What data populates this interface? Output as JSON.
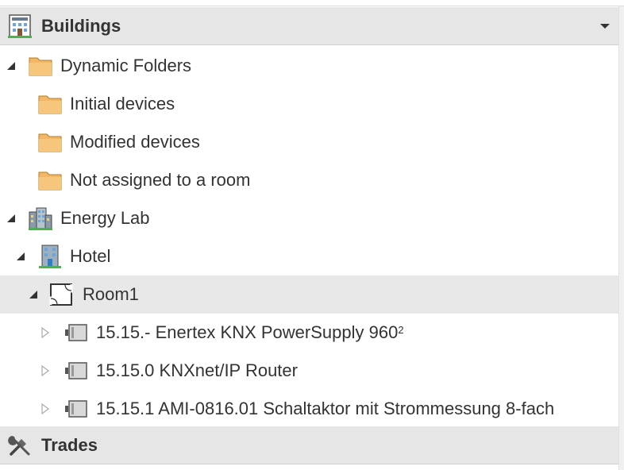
{
  "buildings_panel": {
    "title": "Buildings",
    "icon": "building-panel-icon",
    "dropdown_icon": "dropdown-arrow-icon"
  },
  "tree": {
    "dynamic_folders": {
      "label": "Dynamic Folders",
      "icon": "folder-icon",
      "expanded": true
    },
    "initial_devices": {
      "label": "Initial devices",
      "icon": "folder-icon"
    },
    "modified_devices": {
      "label": "Modified devices",
      "icon": "folder-icon"
    },
    "not_assigned": {
      "label": "Not assigned to a room",
      "icon": "folder-icon"
    },
    "energy_lab": {
      "label": "Energy Lab",
      "icon": "building-complex-icon",
      "expanded": true
    },
    "hotel": {
      "label": "Hotel",
      "icon": "building-icon",
      "expanded": true
    },
    "room1": {
      "label": "Room1",
      "icon": "room-icon",
      "expanded": true,
      "selected": true
    },
    "device1": {
      "label": "15.15.- Enertex KNX PowerSupply 960",
      "sup": "2",
      "icon": "device-icon"
    },
    "device2": {
      "label": "15.15.0 KNXnet/IP Router",
      "icon": "device-icon"
    },
    "device3": {
      "label": "15.15.1 AMI-0816.01 Schaltaktor mit Strommessung 8-fach",
      "icon": "device-icon"
    }
  },
  "trades_panel": {
    "title": "Trades",
    "icon": "tools-icon"
  },
  "colors": {
    "header_bg": "#e6e6e6",
    "selected_bg": "#e8e8e8",
    "folder": "#f2b866",
    "text": "#333333"
  }
}
